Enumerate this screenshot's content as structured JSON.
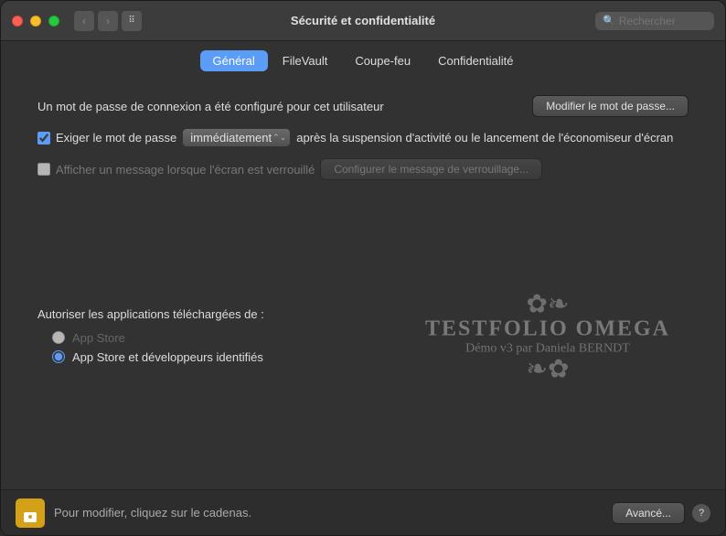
{
  "window": {
    "title": "Sécurité et confidentialité"
  },
  "search": {
    "placeholder": "Rechercher"
  },
  "tabs": [
    {
      "id": "general",
      "label": "Général",
      "active": true
    },
    {
      "id": "filevault",
      "label": "FileVault",
      "active": false
    },
    {
      "id": "firewall",
      "label": "Coupe-feu",
      "active": false
    },
    {
      "id": "privacy",
      "label": "Confidentialité",
      "active": false
    }
  ],
  "password_section": {
    "description": "Un mot de passe de connexion a été configuré pour cet utilisateur",
    "button_label": "Modifier le mot de passe..."
  },
  "require_password": {
    "checkbox_label": "Exiger le mot de passe",
    "dropdown_value": "immédiatement",
    "after_text": "après la suspension d'activité ou le lancement de l'économiseur d'écran"
  },
  "screen_lock": {
    "checkbox_label": "Afficher un message lorsque l'écran est verrouillé",
    "button_label": "Configurer le message de verrouillage..."
  },
  "watermark": {
    "ornament_top": "✿❧",
    "title": "TESTFOLIO OMEGA",
    "subtitle": "Démo v3 par Daniela BERNDT",
    "ornament_bottom": "❧✿"
  },
  "download_section": {
    "label": "Autoriser les applications téléchargées de :",
    "options": [
      {
        "id": "appstore",
        "label": "App Store",
        "selected": false
      },
      {
        "id": "appstore_dev",
        "label": "App Store et développeurs identifiés",
        "selected": true
      }
    ]
  },
  "bottom_bar": {
    "text": "Pour modifier, cliquez sur le cadenas.",
    "advanced_button": "Avancé...",
    "help_label": "?"
  }
}
